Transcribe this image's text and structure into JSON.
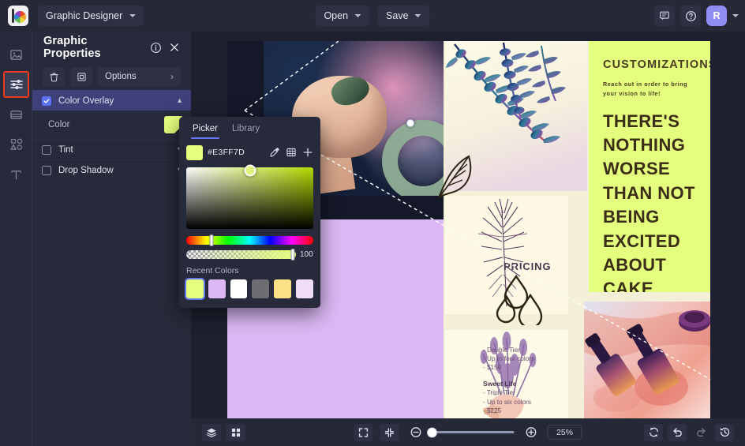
{
  "app": {
    "logo_icon": "color-wheel-logo",
    "document_title": "Graphic Designer"
  },
  "topbar": {
    "open_label": "Open",
    "save_label": "Save",
    "comment_icon": "comment-icon",
    "help_icon": "help-circle-icon",
    "avatar_initial": "R",
    "avatar_color": "#8e8ef5"
  },
  "rail": {
    "items": [
      {
        "icon": "image-icon",
        "name": "sidebar-item-image"
      },
      {
        "icon": "sliders-icon",
        "name": "sidebar-item-properties"
      },
      {
        "icon": "layout-icon",
        "name": "sidebar-item-layout"
      },
      {
        "icon": "shapes-icon",
        "name": "sidebar-item-shapes"
      },
      {
        "icon": "text-icon",
        "name": "sidebar-item-text"
      }
    ],
    "selected_index": 1,
    "selection_outline_color": "#f23a20"
  },
  "properties": {
    "title": "Graphic Properties",
    "info_icon": "info-circle-icon",
    "close_icon": "close-icon",
    "delete_icon": "trash-icon",
    "duplicate_icon": "duplicate-icon",
    "options_label": "Options",
    "options_arrow": "chevron-right-icon",
    "rows": [
      {
        "label": "Color Overlay",
        "checked": true,
        "expanded": true
      },
      {
        "label": "Tint",
        "checked": false,
        "expanded": false
      },
      {
        "label": "Drop Shadow",
        "checked": false,
        "expanded": false
      }
    ],
    "color_label": "Color",
    "color_value": "#E3FF7D"
  },
  "picker": {
    "tabs": [
      {
        "label": "Picker",
        "active": true
      },
      {
        "label": "Library",
        "active": false
      }
    ],
    "hex": "#E3FF7D",
    "swatch_color": "#E3FF7D",
    "eyedropper_icon": "eyedropper-icon",
    "grid_icon": "grid-icon",
    "add_icon": "plus-icon",
    "alpha_value": "100",
    "recent_label": "Recent Colors",
    "recent_colors": [
      {
        "hex": "#E3FF7D",
        "selected": true
      },
      {
        "hex": "#DDB8F7",
        "selected": false
      },
      {
        "hex": "#FFFFFF",
        "selected": false
      },
      {
        "hex": "#6E6E72",
        "selected": false
      },
      {
        "hex": "#FBE186",
        "selected": false
      },
      {
        "hex": "#F0DEF9",
        "selected": false
      }
    ]
  },
  "canvas": {
    "poster": {
      "neon_color": "#E3FF7D",
      "lavender_color": "#DCB9F5",
      "heading": "CUSTOMIZATIONS",
      "subheading": "Reach out in order to bring\nyour vision to life!",
      "big_quote": "THERE'S NOTHING WORSE THAN NOT BEING EXCITED ABOUT CAKE",
      "pricing_title": "PRICING",
      "pricing_items": [
        "- Double Tier",
        "- Up to four colors",
        "- $150"
      ],
      "pricing_group_2_title": "Sweet Life",
      "pricing_group_2_items": [
        "- Triple Tier",
        "- Up to six colors",
        "- $225"
      ]
    }
  },
  "bottombar": {
    "layers_icon": "layers-icon",
    "grid_view_icon": "grid-view-icon",
    "fit_icon": "fit-to-screen-icon",
    "actual_size_icon": "zoom-to-fit-icon",
    "zoom_out_icon": "zoom-out-icon",
    "zoom_in_icon": "zoom-in-icon",
    "zoom_level": "25%",
    "refresh_icon": "refresh-icon",
    "undo_icon": "undo-icon",
    "redo_icon": "redo-icon",
    "history_icon": "history-icon",
    "redo_disabled": true
  }
}
